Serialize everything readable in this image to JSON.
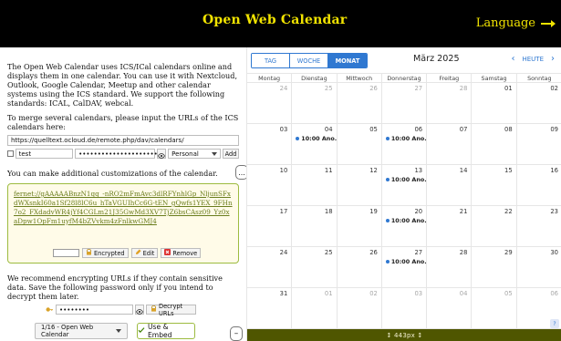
{
  "header": {
    "title": "Open Web Calendar",
    "language_label": "Language",
    "language_icon": "arrow-right-icon",
    "accent_color": "#f1e300",
    "background": "#000000"
  },
  "left_panel": {
    "intro_text": "The Open Web Calendar uses ICS/ICal calendars online and displays them in one calendar. You can use it with Nextcloud, Outlook, Google Calendar, Meetup and other calendar systems using the ICS standard. We support the following standards: ICAL, CalDAV, webcal.",
    "merge_text": "To merge several calendars, please input the URLs of the ICS calendars here:",
    "calendar_url_value": "https://quelltext.ocloud.de/remote.php/dav/calendars/",
    "username_value": "test",
    "password_value": "••••••••••••••••••••••",
    "calendar_type_selected": "Personal",
    "add_button": "Add",
    "customize_text": "You can make additional customizations of the calendar.",
    "encrypted_link_text": "fernet://gAAAAABnzN1qq_-nRO2mFmAvc3dlRFYnhlGp_NljunSFxdWXsnkI60a1Sf28l8lC6u_hTaVGUIhCc6G-tEN_gQwfs1YEX_9FHn7o2_FXdadvWR4jYf4CGLm21J35GwMd3XV7TjZ6bsCAsz09_Yz0xaDpw1OpFm1uyfM4bZVvkm4zFnlkwGMJ4",
    "encrypted_label": "Encrypted",
    "edit_button": "Edit",
    "remove_button": "Remove",
    "encrypt_text": "We recommend encrypting URLs if they contain sensitive data. Save the following password only if you intend to decrypt them later.",
    "password_field_value": "••••••••",
    "decrypt_button": "Decrypt URLs",
    "preset_selected": "1/16 - Open Web Calendar",
    "use_embed_button": "Use & Embed",
    "ellipsis_button": "...",
    "minus_button": "–"
  },
  "calendar": {
    "views": [
      {
        "label": "TAG",
        "active": false
      },
      {
        "label": "WOCHE",
        "active": false
      },
      {
        "label": "MONAT",
        "active": true
      }
    ],
    "month_title": "März 2025",
    "today_label": "HEUTE",
    "weekdays": [
      "Montag",
      "Dienstag",
      "Mittwoch",
      "Donnerstag",
      "Freitag",
      "Samstag",
      "Sonntag"
    ],
    "weeks": [
      [
        {
          "day": "24",
          "muted": true
        },
        {
          "day": "25",
          "muted": true
        },
        {
          "day": "26",
          "muted": true
        },
        {
          "day": "27",
          "muted": true
        },
        {
          "day": "28",
          "muted": true
        },
        {
          "day": "01",
          "muted": false
        },
        {
          "day": "02",
          "muted": false
        }
      ],
      [
        {
          "day": "03",
          "muted": false
        },
        {
          "day": "04",
          "muted": false,
          "event": "10:00 Ano..."
        },
        {
          "day": "05",
          "muted": false
        },
        {
          "day": "06",
          "muted": false,
          "event": "10:00 Ano..."
        },
        {
          "day": "07",
          "muted": false
        },
        {
          "day": "08",
          "muted": false
        },
        {
          "day": "09",
          "muted": false
        }
      ],
      [
        {
          "day": "10",
          "muted": false
        },
        {
          "day": "11",
          "muted": false
        },
        {
          "day": "12",
          "muted": false
        },
        {
          "day": "13",
          "muted": false,
          "event": "10:00 Ano..."
        },
        {
          "day": "14",
          "muted": false
        },
        {
          "day": "15",
          "muted": false
        },
        {
          "day": "16",
          "muted": false
        }
      ],
      [
        {
          "day": "17",
          "muted": false
        },
        {
          "day": "18",
          "muted": false
        },
        {
          "day": "19",
          "muted": false
        },
        {
          "day": "20",
          "muted": false,
          "event": "10:00 Ano..."
        },
        {
          "day": "21",
          "muted": false
        },
        {
          "day": "22",
          "muted": false
        },
        {
          "day": "23",
          "muted": false
        }
      ],
      [
        {
          "day": "24",
          "muted": false
        },
        {
          "day": "25",
          "muted": false
        },
        {
          "day": "26",
          "muted": false
        },
        {
          "day": "27",
          "muted": false,
          "event": "10:00 Ano..."
        },
        {
          "day": "28",
          "muted": false
        },
        {
          "day": "29",
          "muted": false
        },
        {
          "day": "30",
          "muted": false
        }
      ],
      [
        {
          "day": "31",
          "muted": false
        },
        {
          "day": "01",
          "muted": true
        },
        {
          "day": "02",
          "muted": true
        },
        {
          "day": "03",
          "muted": true
        },
        {
          "day": "04",
          "muted": true
        },
        {
          "day": "05",
          "muted": true
        },
        {
          "day": "06",
          "muted": true
        }
      ]
    ],
    "help_label": "?",
    "height_label": "↕ 443px ↕",
    "blue": "#2f78d1",
    "olive": "#4f5600"
  }
}
